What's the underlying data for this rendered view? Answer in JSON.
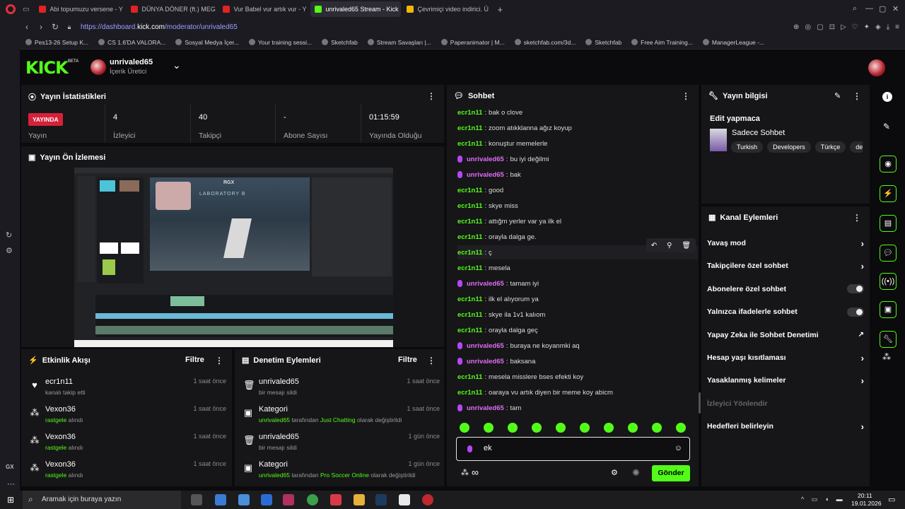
{
  "browser": {
    "tabs": [
      {
        "label": "Abi topumuzu versene - Y",
        "color": "#e02424",
        "active": false
      },
      {
        "label": "DÜNYA DÖNER (ft.) MEG",
        "color": "#e02424",
        "active": false
      },
      {
        "label": "Vur Babel vur artık vur - Y",
        "color": "#e02424",
        "active": false
      },
      {
        "label": "unrivaled65 Stream - Kick",
        "color": "#53fc18",
        "active": true
      },
      {
        "label": "Çevrimiçi video indirici. Ü",
        "color": "#f2b705",
        "active": false
      }
    ],
    "url_prefix": "https://dashboard.",
    "url_domain": "kick.com",
    "url_path": "/moderator/unrivaled65",
    "bookmarks": [
      "Pes13-26 Setup K...",
      "CS 1.6'DA VALORA...",
      "Sosyal Medya İçer...",
      "Your training sessi...",
      "Sketchfab",
      "Stream Savaşları |...",
      "Paperanimator | M...",
      "sketchfab.com/3d...",
      "Sketchfab",
      "Free Aim Training...",
      "ManagerLeague -..."
    ]
  },
  "kick": {
    "logo": "KICK",
    "beta": "BETA",
    "username": "unrivaled65",
    "role": "İçerik Üretici"
  },
  "stats": {
    "title": "Yayın İstatistikleri",
    "live_badge": "YAYINDA",
    "live_label": "Yayın",
    "items": [
      {
        "value": "4",
        "label": "İzleyici"
      },
      {
        "value": "40",
        "label": "Takipçi"
      },
      {
        "value": "-",
        "label": "Abone Sayısı"
      },
      {
        "value": "01:15:59",
        "label": "Yayında Olduğu"
      }
    ]
  },
  "preview": {
    "title": "Yayın Ön İzlemesi",
    "rgx": "RGX",
    "lab": "LABORATORY B"
  },
  "activity": {
    "title": "Etkinlik Akışı",
    "filter": "Filtre",
    "items": [
      {
        "name": "ecr1n11",
        "sub": "kanalı takip etti",
        "time": "1 saat önce"
      },
      {
        "name": "Vexon36",
        "sub_green": "rastgele",
        "sub": " alındı",
        "time": "1 saat önce"
      },
      {
        "name": "Vexon36",
        "sub_green": "rastgele",
        "sub": " alındı",
        "time": "1 saat önce"
      },
      {
        "name": "Vexon36",
        "sub_green": "rastgele",
        "sub": " alındı",
        "time": "1 saat önce"
      }
    ]
  },
  "moderation": {
    "title": "Denetim Eylemleri",
    "filter": "Filtre",
    "items": [
      {
        "name": "unrivaled65",
        "sub": "bir mesajı sildi",
        "time": "1 saat önce"
      },
      {
        "name": "Kategori",
        "sub_a": "unrivaled65",
        "sub_b": " tarafından ",
        "sub_c": "Just Chatting",
        "sub_d": " olarak değiştirildi",
        "time": "1 saat önce"
      },
      {
        "name": "unrivaled65",
        "sub": "bir mesajı sildi",
        "time": "1 gün önce"
      },
      {
        "name": "Kategori",
        "sub_a": "unrivaled65",
        "sub_b": " tarafından ",
        "sub_c": "Pro Soccer Online",
        "sub_d": " olarak değiştirildi",
        "time": "1 gün önce"
      }
    ]
  },
  "chat": {
    "title": "Sohbet",
    "messages": [
      {
        "user": "ecr1n11",
        "color": "g",
        "text": "bak o clove"
      },
      {
        "user": "ecr1n11",
        "color": "g",
        "text": "zoom atıkklanna ağız koyup"
      },
      {
        "user": "ecr1n11",
        "color": "g",
        "text": "konuştur memelerle"
      },
      {
        "user": "unrivaled65",
        "color": "p",
        "text": "bu iyi değilmi"
      },
      {
        "user": "unrivaled65",
        "color": "p",
        "text": "bak"
      },
      {
        "user": "ecr1n11",
        "color": "g",
        "text": "good"
      },
      {
        "user": "ecr1n11",
        "color": "g",
        "text": "skye miss"
      },
      {
        "user": "ecr1n11",
        "color": "g",
        "text": "attığm yerler var ya ilk el"
      },
      {
        "user": "ecr1n11",
        "color": "g",
        "text": "orayla dalga ge."
      },
      {
        "user": "ecr1n11",
        "color": "g",
        "text": "ç"
      },
      {
        "user": "ecr1n11",
        "color": "g",
        "text": "mesela"
      },
      {
        "user": "unrivaled65",
        "color": "p",
        "text": "tamam iyi"
      },
      {
        "user": "ecr1n11",
        "color": "g",
        "text": "ilk el alıyorum ya"
      },
      {
        "user": "ecr1n11",
        "color": "g",
        "text": "skye ila 1v1 kalıom"
      },
      {
        "user": "ecr1n11",
        "color": "g",
        "text": "orayla dalga geç"
      },
      {
        "user": "unrivaled65",
        "color": "p",
        "text": "buraya ne koyanmki aq"
      },
      {
        "user": "unrivaled65",
        "color": "p",
        "text": "baksana"
      },
      {
        "user": "ecr1n11",
        "color": "g",
        "text": "mesela misslere bses efekti koy"
      },
      {
        "user": "ecr1n11",
        "color": "g",
        "text": "oaraya vu artık diyen bir meme koy abicm"
      },
      {
        "user": "unrivaled65",
        "color": "p",
        "text": "tam"
      }
    ],
    "input_value": "ek",
    "send_label": "Gönder"
  },
  "stream_info": {
    "title": "Yayın bilgisi",
    "stream_title": "Edit yapmaca",
    "category": "Sadece Sohbet",
    "tags": [
      "Turkish",
      "Developers",
      "Türkçe",
      "deve"
    ]
  },
  "channel_actions": {
    "title": "Kanal Eylemleri",
    "items": [
      {
        "label": "Yavaş mod",
        "control": "chevron"
      },
      {
        "label": "Takipçilere özel sohbet",
        "control": "chevron"
      },
      {
        "label": "Abonelere özel sohbet",
        "control": "toggle"
      },
      {
        "label": "Yalnızca ifadelerle sohbet",
        "control": "toggle"
      },
      {
        "label": "Yapay Zeka ile Sohbet Denetimi",
        "control": "external"
      },
      {
        "label": "Hesap yaşı kısıtlaması",
        "control": "chevron"
      },
      {
        "label": "Yasaklanmış kelimeler",
        "control": "chevron"
      },
      {
        "label": "İzleyici Yönlendir",
        "control": "disabled"
      },
      {
        "label": "Hedefleri belirleyin",
        "control": "chevron"
      }
    ]
  },
  "taskbar": {
    "search_placeholder": "Aramak için buraya yazın",
    "time": "20:11",
    "date": "19.01.2026"
  }
}
